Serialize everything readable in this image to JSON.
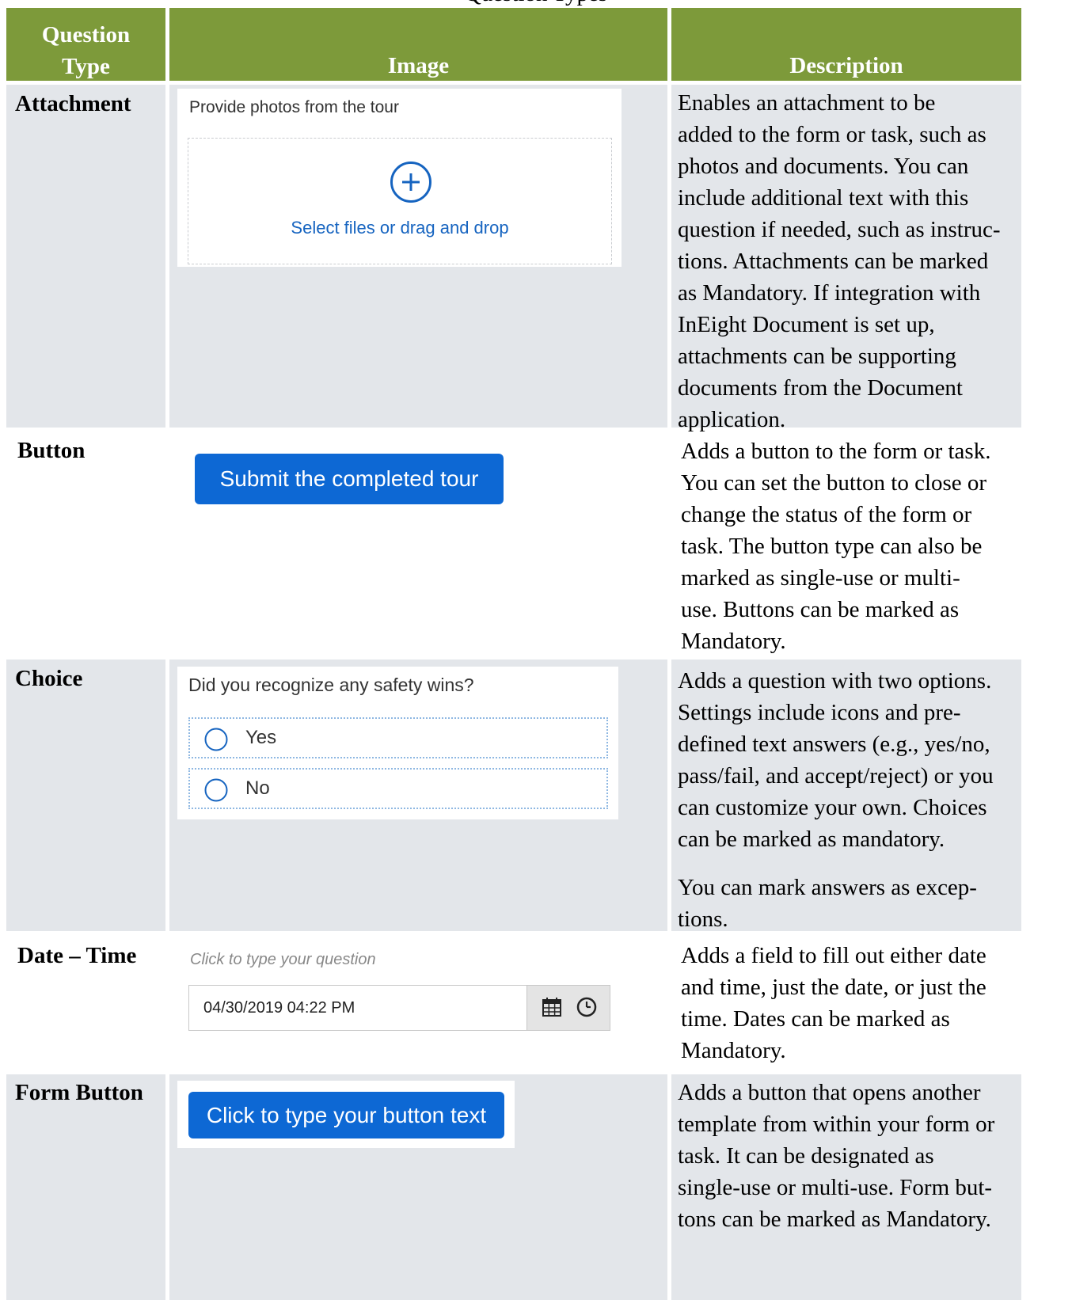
{
  "table": {
    "caption": "Question Types",
    "headers": {
      "type": "Question Type",
      "image": "Image",
      "description": "Description"
    },
    "rows": [
      {
        "type": "Attachment",
        "widget": {
          "label": "Provide photos from the tour",
          "drop_text": "Select files or drag and drop",
          "icon": "plus-circle-icon"
        },
        "description": [
          "Enables an attachment to be",
          "added to the form or task, such as",
          "photos and documents. You can",
          "include additional text with this",
          "question if needed, such as instruc-",
          "tions. Attachments can be marked",
          "as Mandatory. If integration with",
          "InEight Document is set up,",
          "attachments can be supporting",
          "documents from the Document",
          "application."
        ]
      },
      {
        "type": "Button",
        "widget": {
          "button_label": "Submit the completed tour"
        },
        "description": [
          "Adds a button to the form or task.",
          "You can set the button to close or",
          "change the status of the form or",
          "task. The button type can also be",
          "marked as single-use or multi-",
          "use. Buttons can be marked as",
          "Mandatory."
        ]
      },
      {
        "type": "Choice",
        "widget": {
          "question": "Did you recognize any safety wins?",
          "options": [
            "Yes",
            "No"
          ]
        },
        "description": [
          "Adds a question with two options.",
          "Settings include icons and pre-",
          "defined text answers (e.g., yes/no,",
          "pass/fail, and accept/reject) or you",
          "can customize your own. Choices",
          "can be marked as mandatory."
        ],
        "description_extra": [
          "You can mark answers as excep-",
          "tions."
        ]
      },
      {
        "type": "Date – Time",
        "widget": {
          "hint": "Click to type your question",
          "value": "04/30/2019 04:22 PM"
        },
        "description": [
          "Adds a field to fill out either date",
          "and time, just the date, or just the",
          "time. Dates can be marked as",
          "Mandatory."
        ]
      },
      {
        "type": "Form Button",
        "widget": {
          "button_label": "Click to type your button text"
        },
        "description": [
          "Adds a button that opens another",
          "template from within your form or",
          "task. It can be designated as",
          "single-use or multi-use. Form but-",
          "tons can be marked as Mandatory."
        ]
      }
    ]
  },
  "colors": {
    "header_green": "#7d9a3a",
    "row_grey": "#e3e6ea",
    "accent_blue": "#0d68d4",
    "link_blue": "#1664c0"
  }
}
